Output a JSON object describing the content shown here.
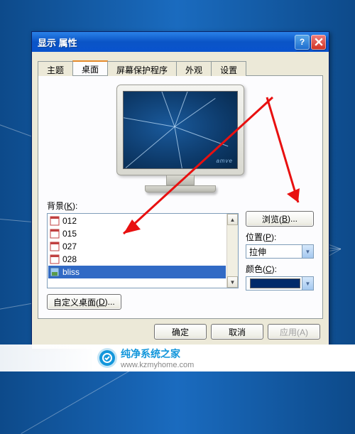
{
  "window": {
    "title": "显示 属性",
    "help_icon": "help-icon",
    "close_icon": "close-icon"
  },
  "tabs": [
    {
      "label": "主题",
      "active": false
    },
    {
      "label": "桌面",
      "active": true
    },
    {
      "label": "屏幕保护程序",
      "active": false
    },
    {
      "label": "外观",
      "active": false
    },
    {
      "label": "设置",
      "active": false
    }
  ],
  "preview": {
    "brand": "amve"
  },
  "background": {
    "label_pre": "背景(",
    "label_key": "K",
    "label_post": "):",
    "items": [
      {
        "name": "012",
        "selected": false
      },
      {
        "name": "015",
        "selected": false
      },
      {
        "name": "027",
        "selected": false
      },
      {
        "name": "028",
        "selected": false
      },
      {
        "name": "bliss",
        "selected": true
      }
    ]
  },
  "browse_btn": {
    "pre": "浏览(",
    "key": "B",
    "post": ")..."
  },
  "position": {
    "label_pre": "位置(",
    "label_key": "P",
    "label_post": "):",
    "value": "拉伸"
  },
  "color": {
    "label_pre": "颜色(",
    "label_key": "C",
    "label_post": "):",
    "value": "#002a6a"
  },
  "customize_btn": {
    "pre": "自定义桌面(",
    "key": "D",
    "post": ")..."
  },
  "dialog_buttons": {
    "ok": "确定",
    "cancel": "取消",
    "apply": "应用(A)"
  },
  "watermark": {
    "brand": "纯净系统之家",
    "url": "www.kzmyhome.com"
  }
}
